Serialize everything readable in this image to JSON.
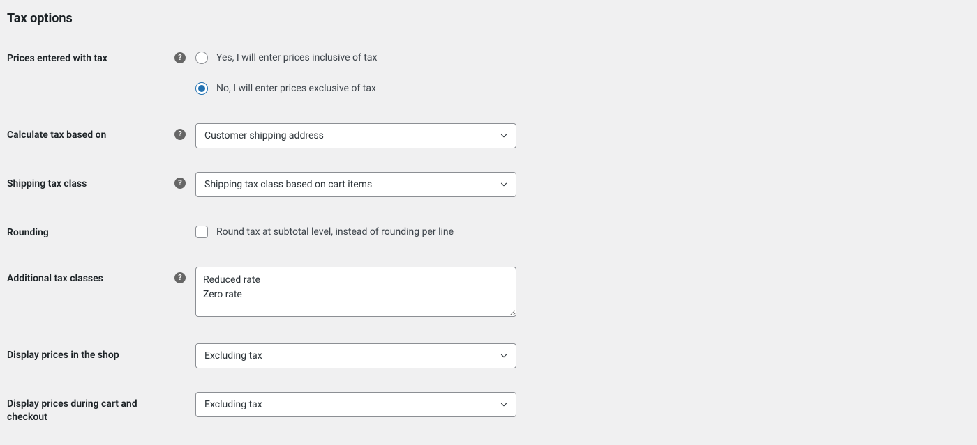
{
  "section": {
    "title": "Tax options"
  },
  "fields": {
    "prices_entered_with_tax": {
      "label": "Prices entered with tax",
      "has_help": true,
      "options": [
        {
          "label": "Yes, I will enter prices inclusive of tax",
          "checked": false
        },
        {
          "label": "No, I will enter prices exclusive of tax",
          "checked": true
        }
      ]
    },
    "calculate_tax_based_on": {
      "label": "Calculate tax based on",
      "has_help": true,
      "value": "Customer shipping address"
    },
    "shipping_tax_class": {
      "label": "Shipping tax class",
      "has_help": true,
      "value": "Shipping tax class based on cart items"
    },
    "rounding": {
      "label": "Rounding",
      "has_help": false,
      "checkbox_label": "Round tax at subtotal level, instead of rounding per line",
      "checked": false
    },
    "additional_tax_classes": {
      "label": "Additional tax classes",
      "has_help": true,
      "value": "Reduced rate\nZero rate"
    },
    "display_prices_in_shop": {
      "label": "Display prices in the shop",
      "has_help": false,
      "value": "Excluding tax"
    },
    "display_prices_cart_checkout": {
      "label": "Display prices during cart and checkout",
      "has_help": false,
      "value": "Excluding tax"
    }
  }
}
